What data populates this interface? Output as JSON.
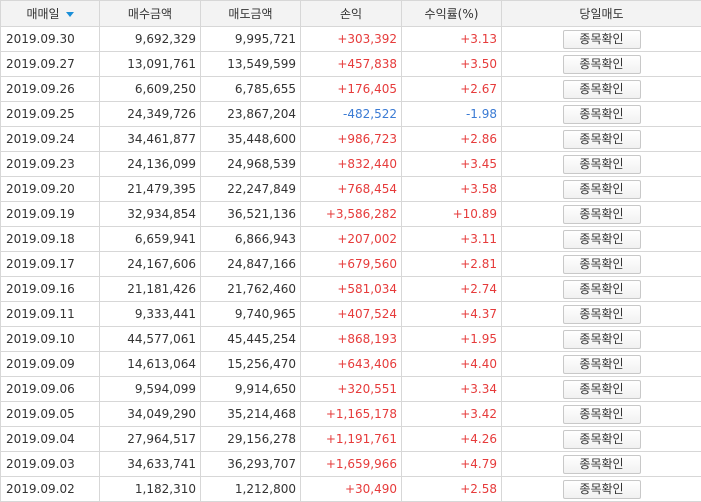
{
  "colors": {
    "up": "#e63b3b",
    "down": "#3b7bd4",
    "sort_icon": "#1a8fd8"
  },
  "headers": {
    "trade_date": "매매일",
    "buy_amount": "매수금액",
    "sell_amount": "매도금액",
    "profit": "손익",
    "return_rate": "수익률(%)",
    "day_sell": "당일매도"
  },
  "sort_icon": "caret-down-icon",
  "button_label": "종목확인",
  "rows": [
    {
      "date": "2019.09.30",
      "buy": "9,692,329",
      "sell": "9,995,721",
      "pnl": "+303,392",
      "rate": "+3.13",
      "dir": "up"
    },
    {
      "date": "2019.09.27",
      "buy": "13,091,761",
      "sell": "13,549,599",
      "pnl": "+457,838",
      "rate": "+3.50",
      "dir": "up"
    },
    {
      "date": "2019.09.26",
      "buy": "6,609,250",
      "sell": "6,785,655",
      "pnl": "+176,405",
      "rate": "+2.67",
      "dir": "up"
    },
    {
      "date": "2019.09.25",
      "buy": "24,349,726",
      "sell": "23,867,204",
      "pnl": "-482,522",
      "rate": "-1.98",
      "dir": "down"
    },
    {
      "date": "2019.09.24",
      "buy": "34,461,877",
      "sell": "35,448,600",
      "pnl": "+986,723",
      "rate": "+2.86",
      "dir": "up"
    },
    {
      "date": "2019.09.23",
      "buy": "24,136,099",
      "sell": "24,968,539",
      "pnl": "+832,440",
      "rate": "+3.45",
      "dir": "up"
    },
    {
      "date": "2019.09.20",
      "buy": "21,479,395",
      "sell": "22,247,849",
      "pnl": "+768,454",
      "rate": "+3.58",
      "dir": "up"
    },
    {
      "date": "2019.09.19",
      "buy": "32,934,854",
      "sell": "36,521,136",
      "pnl": "+3,586,282",
      "rate": "+10.89",
      "dir": "up"
    },
    {
      "date": "2019.09.18",
      "buy": "6,659,941",
      "sell": "6,866,943",
      "pnl": "+207,002",
      "rate": "+3.11",
      "dir": "up"
    },
    {
      "date": "2019.09.17",
      "buy": "24,167,606",
      "sell": "24,847,166",
      "pnl": "+679,560",
      "rate": "+2.81",
      "dir": "up"
    },
    {
      "date": "2019.09.16",
      "buy": "21,181,426",
      "sell": "21,762,460",
      "pnl": "+581,034",
      "rate": "+2.74",
      "dir": "up"
    },
    {
      "date": "2019.09.11",
      "buy": "9,333,441",
      "sell": "9,740,965",
      "pnl": "+407,524",
      "rate": "+4.37",
      "dir": "up"
    },
    {
      "date": "2019.09.10",
      "buy": "44,577,061",
      "sell": "45,445,254",
      "pnl": "+868,193",
      "rate": "+1.95",
      "dir": "up"
    },
    {
      "date": "2019.09.09",
      "buy": "14,613,064",
      "sell": "15,256,470",
      "pnl": "+643,406",
      "rate": "+4.40",
      "dir": "up"
    },
    {
      "date": "2019.09.06",
      "buy": "9,594,099",
      "sell": "9,914,650",
      "pnl": "+320,551",
      "rate": "+3.34",
      "dir": "up"
    },
    {
      "date": "2019.09.05",
      "buy": "34,049,290",
      "sell": "35,214,468",
      "pnl": "+1,165,178",
      "rate": "+3.42",
      "dir": "up"
    },
    {
      "date": "2019.09.04",
      "buy": "27,964,517",
      "sell": "29,156,278",
      "pnl": "+1,191,761",
      "rate": "+4.26",
      "dir": "up"
    },
    {
      "date": "2019.09.03",
      "buy": "34,633,741",
      "sell": "36,293,707",
      "pnl": "+1,659,966",
      "rate": "+4.79",
      "dir": "up"
    },
    {
      "date": "2019.09.02",
      "buy": "1,182,310",
      "sell": "1,212,800",
      "pnl": "+30,490",
      "rate": "+2.58",
      "dir": "up"
    }
  ]
}
